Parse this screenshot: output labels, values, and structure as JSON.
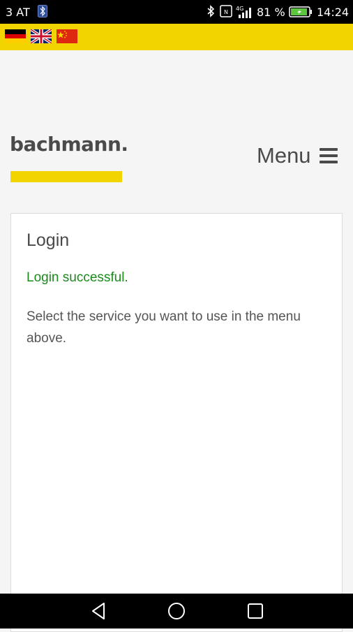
{
  "status_bar": {
    "carrier": "3 AT",
    "battery_percent": "81 %",
    "clock": "14:24",
    "icons": [
      "notification-icon",
      "bluetooth-icon",
      "nfc-icon",
      "signal-4g-icon",
      "battery-icon"
    ]
  },
  "languages": [
    {
      "name": "german-flag-icon"
    },
    {
      "name": "uk-flag-icon"
    },
    {
      "name": "china-flag-icon"
    }
  ],
  "header": {
    "logo_text": "bachmann.",
    "menu_label": "Menu"
  },
  "card": {
    "title": "Login",
    "success_message": "Login successful.",
    "info_text": "Select the service you want to use in the menu above."
  },
  "nav_bar": {
    "icons": [
      "back-icon",
      "home-icon",
      "recents-icon"
    ]
  },
  "colors": {
    "accent_yellow": "#f2d500",
    "success_green": "#1a8a1a",
    "text_gray": "#4a4a4a"
  }
}
